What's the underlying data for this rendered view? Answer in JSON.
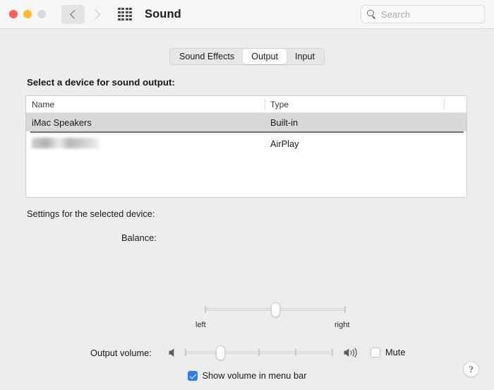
{
  "window": {
    "title": "Sound",
    "traffic_lights": [
      "close-red",
      "minimize-yellow",
      "zoom-gray-disabled"
    ],
    "nav": {
      "back_icon": "chevron-left-icon",
      "forward_icon": "chevron-right-icon",
      "grid_icon": "show-all-grid-icon"
    }
  },
  "search": {
    "placeholder": "Search",
    "value": "",
    "icon": "search-icon"
  },
  "tabs": [
    {
      "label": "Sound Effects",
      "active": false
    },
    {
      "label": "Output",
      "active": true
    },
    {
      "label": "Input",
      "active": false
    }
  ],
  "main": {
    "section_title": "Select a device for sound output:",
    "table": {
      "columns": [
        "Name",
        "Type"
      ],
      "rows": [
        {
          "name": "iMac Speakers",
          "type": "Built-in",
          "selected": true,
          "redacted": false
        },
        {
          "name": "",
          "type": "AirPlay",
          "selected": false,
          "redacted": true
        }
      ]
    },
    "settings_label": "Settings for the selected device:",
    "balance": {
      "label": "Balance:",
      "left_label": "left",
      "right_label": "right",
      "value_percent": 50
    },
    "help_button": {
      "label": "?",
      "icon": "help-question-icon"
    }
  },
  "footer": {
    "output_volume_label": "Output volume:",
    "volume_percent": 24,
    "low_volume_icon": "speaker-icon",
    "high_volume_icon": "speaker-waves-icon",
    "mute": {
      "label": "Mute",
      "checked": false
    },
    "show_volume_menu_bar": {
      "label": "Show volume in menu bar",
      "checked": true
    }
  },
  "colors": {
    "window_bg": "#ececec",
    "titlebar_bg": "#f6f6f6",
    "panel_bg": "#ededed",
    "selection_gray": "#d8d8d8",
    "accent_blue": "#2f7cf6",
    "close_red": "#ff5f57",
    "minimize_yellow": "#febc2e",
    "zoom_gray": "#d9d9d9"
  }
}
